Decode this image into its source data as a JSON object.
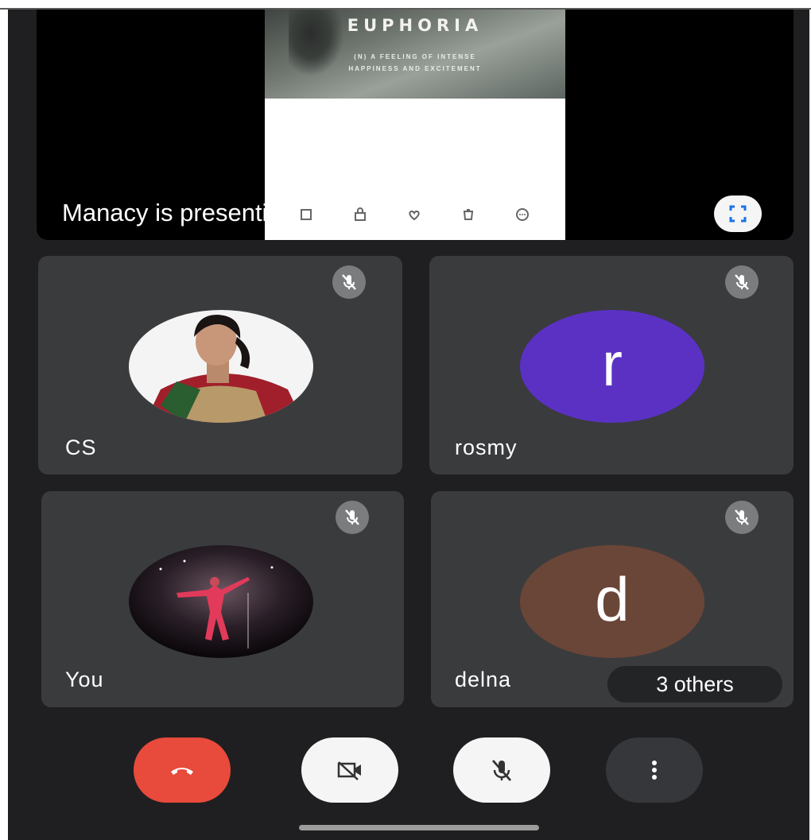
{
  "presentation": {
    "label": "Manacy is presenting",
    "slide_title": "EUPHORIA",
    "slide_subtitle_line1": "(N) A FEELING OF INTENSE",
    "slide_subtitle_line2": "HAPPINESS AND EXCITEMENT",
    "fullscreen_icon": "fullscreen-icon"
  },
  "participants": [
    {
      "name": "CS",
      "avatar_type": "photo",
      "muted": true
    },
    {
      "name": "rosmy",
      "avatar_letter": "r",
      "avatar_color": "#5b31c4",
      "muted": true
    },
    {
      "name": "You",
      "avatar_type": "photo",
      "muted": true
    },
    {
      "name": "delna",
      "avatar_letter": "d",
      "avatar_color": "#6a4638",
      "muted": true
    }
  ],
  "others_label": "3 others",
  "controls": {
    "end_call_icon": "hang-up-icon",
    "end_call_color": "#e84a3b",
    "camera_icon": "camera-off-icon",
    "mic_icon": "mic-off-icon",
    "more_icon": "more-vert-icon"
  },
  "colors": {
    "background": "#1f1f21",
    "tile": "#3a3b3d",
    "mute_badge": "#7b7c7e"
  }
}
